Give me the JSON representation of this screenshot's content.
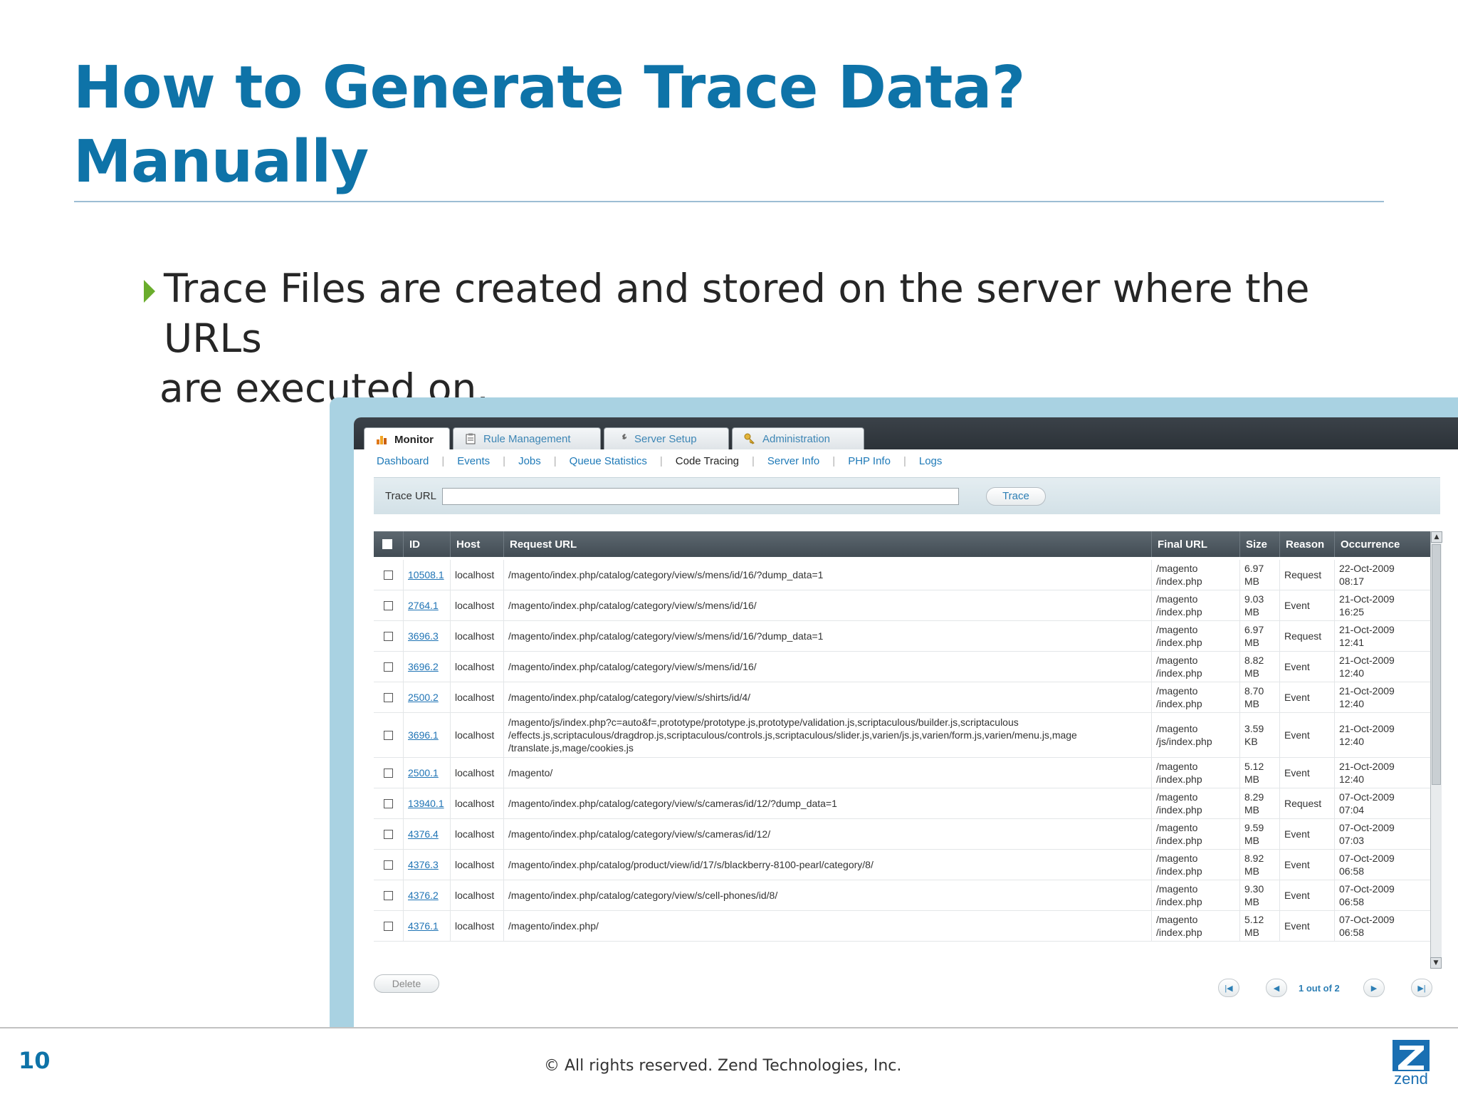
{
  "slide": {
    "title_line1": "How to Generate Trace Data?",
    "title_line2": "Manually",
    "bullet_line1": "Trace Files are created and stored on the server where the URLs",
    "bullet_line2": "are executed on.",
    "page_number": "10",
    "copyright": "© All rights reserved. Zend Technologies, Inc.",
    "logo_text": "zend"
  },
  "app": {
    "tabs": [
      {
        "label": "Monitor",
        "icon": "monitor-chart-icon"
      },
      {
        "label": "Rule Management",
        "icon": "clipboard-icon"
      },
      {
        "label": "Server Setup",
        "icon": "wrench-icon"
      },
      {
        "label": "Administration",
        "icon": "key-icon"
      }
    ],
    "subnav": [
      "Dashboard",
      "Events",
      "Jobs",
      "Queue Statistics",
      "Code Tracing",
      "Server Info",
      "PHP Info",
      "Logs"
    ],
    "trace_label": "Trace URL",
    "trace_input_value": "",
    "trace_button": "Trace",
    "columns": [
      "",
      "ID",
      "Host",
      "Request URL",
      "Final URL",
      "Size",
      "Reason",
      "Occurrence"
    ],
    "rows": [
      {
        "id": "10508.1",
        "host": "localhost",
        "request": "/magento/index.php/catalog/category/view/s/mens/id/16/?dump_data=1",
        "final": "/magento /index.php",
        "size": "6.97 MB",
        "reason": "Request",
        "date": "22-Oct-2009",
        "time": "08:17"
      },
      {
        "id": "2764.1",
        "host": "localhost",
        "request": "/magento/index.php/catalog/category/view/s/mens/id/16/",
        "final": "/magento /index.php",
        "size": "9.03 MB",
        "reason": "Event",
        "date": "21-Oct-2009",
        "time": "16:25"
      },
      {
        "id": "3696.3",
        "host": "localhost",
        "request": "/magento/index.php/catalog/category/view/s/mens/id/16/?dump_data=1",
        "final": "/magento /index.php",
        "size": "6.97 MB",
        "reason": "Request",
        "date": "21-Oct-2009",
        "time": "12:41"
      },
      {
        "id": "3696.2",
        "host": "localhost",
        "request": "/magento/index.php/catalog/category/view/s/mens/id/16/",
        "final": "/magento /index.php",
        "size": "8.82 MB",
        "reason": "Event",
        "date": "21-Oct-2009",
        "time": "12:40"
      },
      {
        "id": "2500.2",
        "host": "localhost",
        "request": "/magento/index.php/catalog/category/view/s/shirts/id/4/",
        "final": "/magento /index.php",
        "size": "8.70 MB",
        "reason": "Event",
        "date": "21-Oct-2009",
        "time": "12:40"
      },
      {
        "id": "3696.1",
        "host": "localhost",
        "request": "/magento/js/index.php?c=auto&f=,prototype/prototype.js,prototype/validation.js,scriptaculous/builder.js,scriptaculous /effects.js,scriptaculous/dragdrop.js,scriptaculous/controls.js,scriptaculous/slider.js,varien/js.js,varien/form.js,varien/menu.js,mage /translate.js,mage/cookies.js",
        "final": "/magento /js/index.php",
        "size": "3.59 KB",
        "reason": "Event",
        "date": "21-Oct-2009",
        "time": "12:40"
      },
      {
        "id": "2500.1",
        "host": "localhost",
        "request": "/magento/",
        "final": "/magento /index.php",
        "size": "5.12 MB",
        "reason": "Event",
        "date": "21-Oct-2009",
        "time": "12:40"
      },
      {
        "id": "13940.1",
        "host": "localhost",
        "request": "/magento/index.php/catalog/category/view/s/cameras/id/12/?dump_data=1",
        "final": "/magento /index.php",
        "size": "8.29 MB",
        "reason": "Request",
        "date": "07-Oct-2009",
        "time": "07:04"
      },
      {
        "id": "4376.4",
        "host": "localhost",
        "request": "/magento/index.php/catalog/category/view/s/cameras/id/12/",
        "final": "/magento /index.php",
        "size": "9.59 MB",
        "reason": "Event",
        "date": "07-Oct-2009",
        "time": "07:03"
      },
      {
        "id": "4376.3",
        "host": "localhost",
        "request": "/magento/index.php/catalog/product/view/id/17/s/blackberry-8100-pearl/category/8/",
        "final": "/magento /index.php",
        "size": "8.92 MB",
        "reason": "Event",
        "date": "07-Oct-2009",
        "time": "06:58"
      },
      {
        "id": "4376.2",
        "host": "localhost",
        "request": "/magento/index.php/catalog/category/view/s/cell-phones/id/8/",
        "final": "/magento /index.php",
        "size": "9.30 MB",
        "reason": "Event",
        "date": "07-Oct-2009",
        "time": "06:58"
      },
      {
        "id": "4376.1",
        "host": "localhost",
        "request": "/magento/index.php/",
        "final": "/magento /index.php",
        "size": "5.12 MB",
        "reason": "Event",
        "date": "07-Oct-2009",
        "time": "06:58"
      }
    ],
    "delete_button": "Delete",
    "pager_text": "1 out of 2"
  },
  "colors": {
    "title": "#0e73a8",
    "bullet_arrow": "#6aad2c",
    "link": "#2074b5"
  }
}
